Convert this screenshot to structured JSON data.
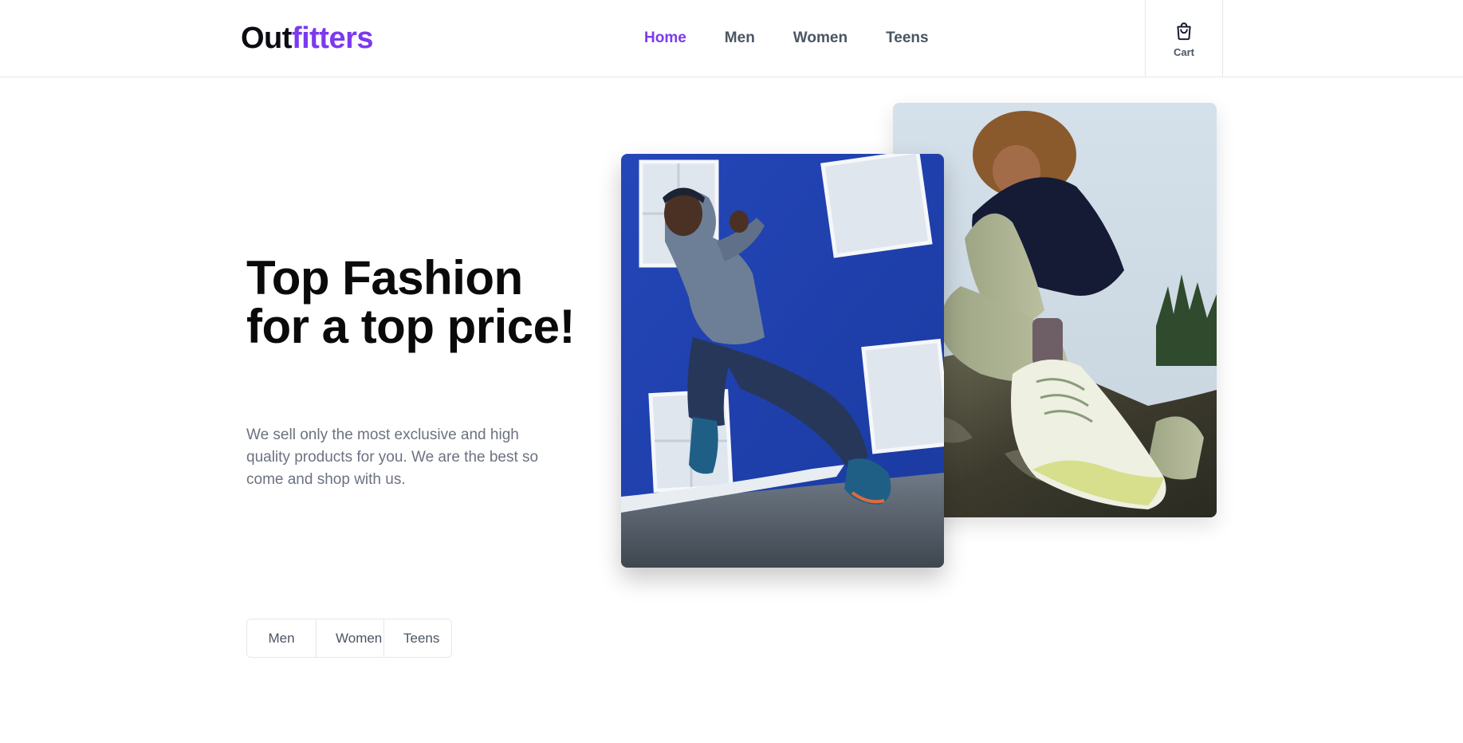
{
  "header": {
    "logo_part1": "Out",
    "logo_part2": "fitters",
    "nav": [
      {
        "label": "Home",
        "active": true
      },
      {
        "label": "Men",
        "active": false
      },
      {
        "label": "Women",
        "active": false
      },
      {
        "label": "Teens",
        "active": false
      }
    ],
    "cart_label": "Cart",
    "cart_icon": "shopping-bag-icon"
  },
  "hero": {
    "title": "Top Fashion for a top price!",
    "description": "We sell only the most exclusive and high quality products for you. We are the best so come and shop with us."
  },
  "categories": {
    "buttons": [
      "Men",
      "Women",
      "Teens"
    ]
  },
  "colors": {
    "accent": "#7c3aed",
    "text_dark": "#0a0a0a",
    "text_muted": "#6b7280",
    "border": "#e5e7eb"
  }
}
